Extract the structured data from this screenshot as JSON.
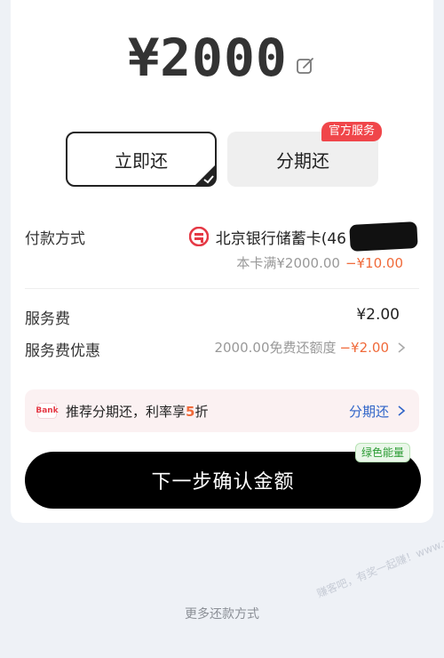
{
  "amount": {
    "value": "¥2000",
    "edit_icon": "edit-icon"
  },
  "tabs": {
    "now_label": "立即还",
    "installment_label": "分期还",
    "official_badge": "官方服务"
  },
  "payment": {
    "label": "付款方式",
    "bank_name": "北京银行储蓄卡(46",
    "coupon_condition": "本卡满¥2000.00",
    "coupon_discount": "−¥10.00"
  },
  "fees": {
    "service_fee_label": "服务费",
    "service_fee_value": "¥2.00",
    "discount_label": "服务费优惠",
    "discount_desc": "2000.00免费还额度",
    "discount_value": "−¥2.00"
  },
  "promo": {
    "logo_text": "Bank",
    "text_prefix": "推荐分期还，利率享",
    "text_number": "5",
    "text_suffix": "折",
    "link_label": "分期还"
  },
  "primary": {
    "button_label": "下一步确认金额",
    "green_badge": "绿色能量"
  },
  "footer": {
    "more_methods": "更多还款方式",
    "watermark": "赚客吧，有奖一起赚！www.zuanke8.com"
  },
  "colors": {
    "accent_red": "#f0464a",
    "discount_orange": "#f06a3a",
    "link_blue": "#2f64c8",
    "green": "#2a9b33"
  }
}
